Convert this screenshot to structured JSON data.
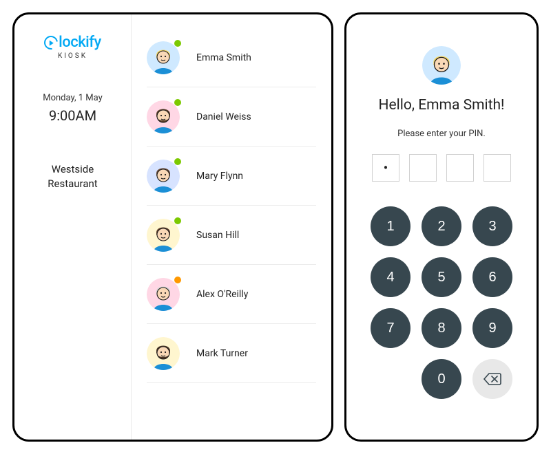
{
  "logo": {
    "main": "lockify",
    "sub": "KIOSK"
  },
  "date": "Monday, 1 May",
  "time": "9:00AM",
  "location_line1": "Westside",
  "location_line2": "Restaurant",
  "employees": [
    {
      "name": "Emma Smith",
      "status": "green",
      "bg": "#cfe9ff",
      "hair": "#f7d968",
      "beard": false
    },
    {
      "name": "Daniel Weiss",
      "status": "green",
      "bg": "#ffd7e5",
      "hair": "#5a3d27",
      "beard": true
    },
    {
      "name": "Mary Flynn",
      "status": "green",
      "bg": "#d7e3ff",
      "hair": "#6a4a34",
      "beard": false
    },
    {
      "name": "Susan Hill",
      "status": "green",
      "bg": "#fff6cf",
      "hair": "#5f3e28",
      "beard": false
    },
    {
      "name": "Alex O'Reilly",
      "status": "orange",
      "bg": "#ffd7e5",
      "hair": "#d4d4d4",
      "beard": false
    },
    {
      "name": "Mark Turner",
      "status": "",
      "bg": "#fff6cf",
      "hair": "#4b3524",
      "beard": true
    }
  ],
  "pin_screen": {
    "avatar": {
      "bg": "#cfe9ff",
      "hair": "#f7d968"
    },
    "greeting": "Hello, Emma Smith!",
    "prompt": "Please enter your PIN.",
    "entered": 1,
    "total": 4
  },
  "keypad": [
    "1",
    "2",
    "3",
    "4",
    "5",
    "6",
    "7",
    "8",
    "9",
    "",
    "0",
    "⌫"
  ]
}
